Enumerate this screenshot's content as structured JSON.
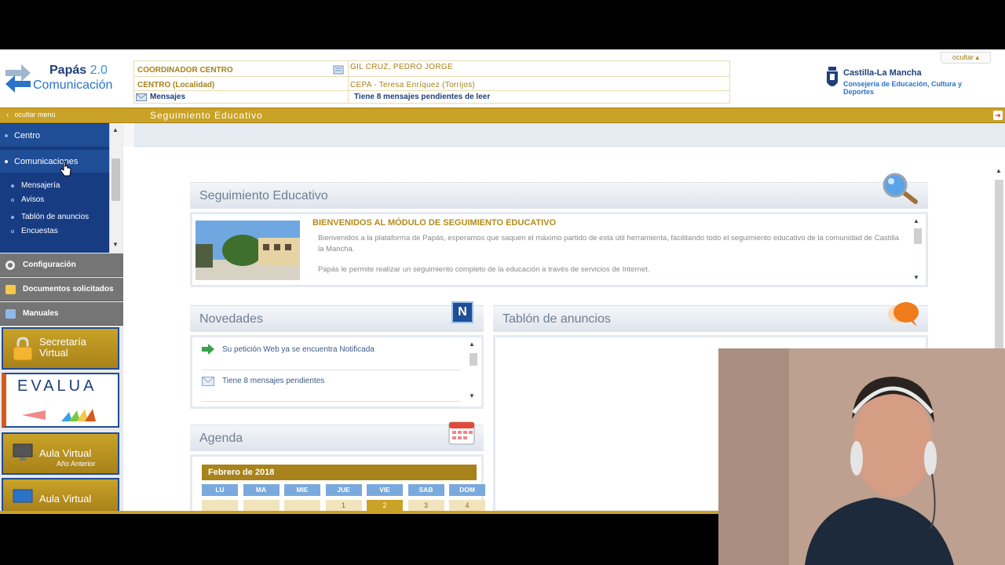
{
  "header": {
    "logo": {
      "title": "Papás",
      "version": "2.0",
      "subtitle": "Comunicación"
    },
    "info": {
      "role_label": "COORDINADOR CENTRO",
      "user_name": "GIL CRUZ, PEDRO JORGE",
      "centro_label": "CENTRO (Localidad)",
      "centro_value": "CEPA - Teresa Enríquez (Torrijos)",
      "mensajes_label": "Mensajes",
      "mensajes_value": "Tiene 8 mensajes pendientes de leer"
    },
    "ocultar": "ocultar",
    "org": {
      "name": "Castilla-La Mancha",
      "dept": "Consejería de Educación, Cultura y Deportes"
    }
  },
  "goldbar": {
    "hide_menu": "ocultar menú",
    "title": "Seguimiento Educativo"
  },
  "sidebar": {
    "nav": [
      {
        "label": "Centro"
      },
      {
        "label": "Comunicaciones"
      }
    ],
    "subnav": [
      "Mensajería",
      "Avisos",
      "Tablón de anuncios",
      "Encuestas"
    ],
    "gray_items": [
      "Configuración",
      "Documentos solicitados",
      "Manuales"
    ],
    "tiles": {
      "secretaria": "Secretaría Virtual",
      "evalua": "EVALUA",
      "aula1": "Aula Virtual",
      "aula1_sub": "Año Anterior",
      "aula2": "Aula Virtual"
    }
  },
  "main": {
    "seguimiento": {
      "title": "Seguimiento Educativo",
      "welcome_title": "BIENVENIDOS AL MÓDULO DE SEGUIMIENTO EDUCATIVO",
      "p1": "Bienvenidos a la plataforma de Papás, esperamos que saquen el máximo partido de esta útil herramienta, facilitando todo el seguimiento educativo de la comunidad de Castilla la Mancha.",
      "p2": "Papás le permite realizar un seguimiento completo de la educación a través de servicios de Internet."
    },
    "novedades": {
      "title": "Novedades",
      "badge": "N",
      "items": [
        "Su petición Web ya se encuentra Notificada",
        "Tiene 8 mensajes pendientes"
      ]
    },
    "tablon": {
      "title": "Tablón de anuncios"
    },
    "agenda": {
      "title": "Agenda",
      "month": "Febrero de 2018",
      "days": [
        "LU",
        "MA",
        "MIE",
        "JUE",
        "VIE",
        "SAB",
        "DOM"
      ],
      "first_row": [
        "",
        "",
        "",
        "1",
        "2",
        "3",
        "4"
      ]
    }
  },
  "colors": {
    "gold": "#c9a227",
    "navy": "#1f4d96",
    "panel_title": "#6f7f93"
  }
}
